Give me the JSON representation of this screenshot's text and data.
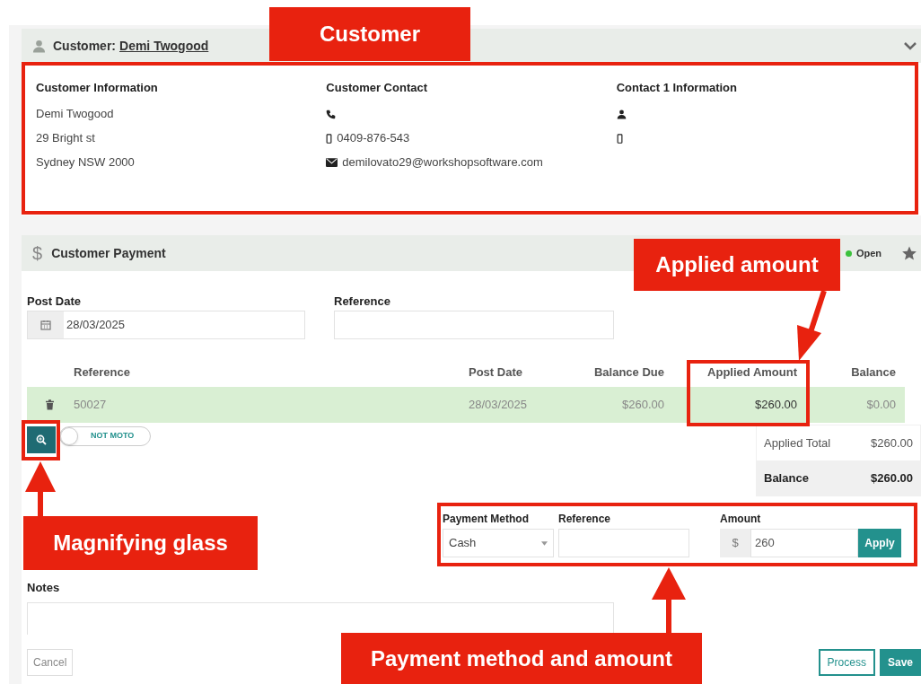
{
  "customer_panel": {
    "title_label": "Customer:",
    "customer_name": "Demi Twogood",
    "columns": [
      {
        "heading": "Customer Information",
        "lines": [
          {
            "kind": "text",
            "text": "Demi Twogood"
          },
          {
            "kind": "text",
            "text": "29 Bright st"
          },
          {
            "kind": "text",
            "text": "Sydney NSW 2000"
          }
        ]
      },
      {
        "heading": "Customer Contact",
        "lines": [
          {
            "kind": "phone"
          },
          {
            "kind": "mobile",
            "text": "0409-876-543"
          },
          {
            "kind": "email",
            "text": "demilovato29@workshopsoftware.com"
          }
        ]
      },
      {
        "heading": "Contact 1 Information",
        "lines": [
          {
            "kind": "person"
          },
          {
            "kind": "mobile"
          }
        ]
      }
    ]
  },
  "payment_panel": {
    "icon": "$",
    "title": "Customer Payment",
    "status": "Open",
    "post_date": {
      "label": "Post Date",
      "value": "28/03/2025"
    },
    "reference": {
      "label": "Reference"
    },
    "table": {
      "columns": [
        "Reference",
        "Post Date",
        "Balance Due",
        "Applied Amount",
        "Balance"
      ],
      "rows": [
        {
          "cells": [
            "50027",
            "28/03/2025",
            "$260.00",
            "$260.00",
            "$0.00"
          ]
        }
      ]
    },
    "moto_toggle": {
      "label": "NOT MOTO",
      "on": false
    },
    "totals": [
      {
        "kind": "subtotal",
        "label": "Applied Total",
        "value": "$260.00"
      },
      {
        "kind": "total",
        "label": "Balance",
        "value": "$260.00"
      }
    ],
    "payment": {
      "method_label": "Payment Method",
      "method_value": "Cash",
      "reference_label": "Reference",
      "amount_label": "Amount",
      "currency": "$",
      "amount": "260",
      "apply": "Apply"
    },
    "notes": {
      "label": "Notes"
    },
    "buttons": {
      "cancel": "Cancel",
      "process": "Process",
      "save": "Save"
    }
  },
  "annotations": [
    "Customer",
    "Applied amount",
    "Magnifying glass",
    "Payment method and amount"
  ]
}
